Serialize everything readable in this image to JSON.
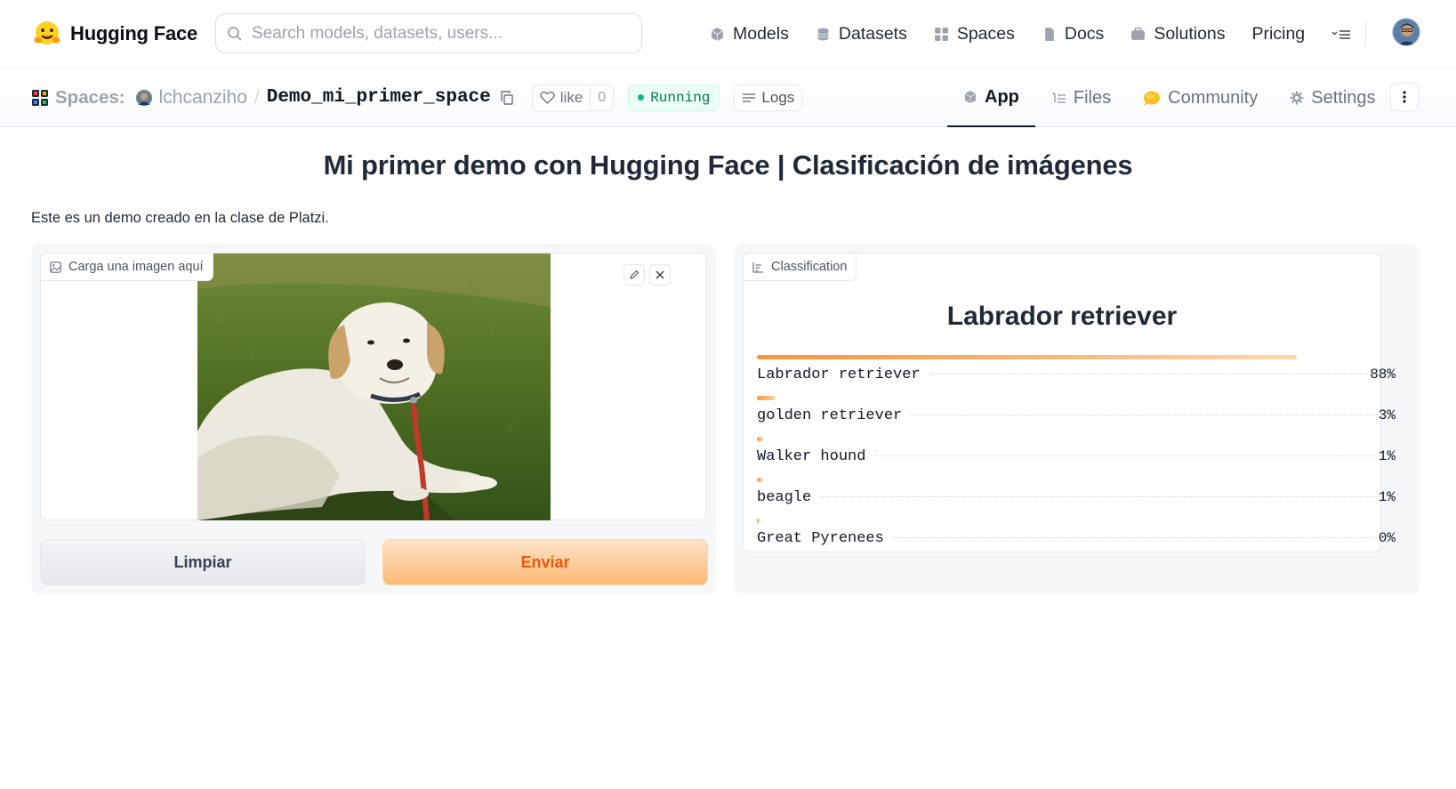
{
  "site": {
    "brand": "Hugging Face",
    "search_placeholder": "Search models, datasets, users..."
  },
  "nav": [
    {
      "label": "Models",
      "icon": "cube-icon"
    },
    {
      "label": "Datasets",
      "icon": "database-icon"
    },
    {
      "label": "Spaces",
      "icon": "grid-icon"
    },
    {
      "label": "Docs",
      "icon": "doc-icon"
    },
    {
      "label": "Solutions",
      "icon": "briefcase-icon"
    },
    {
      "label": "Pricing",
      "icon": ""
    }
  ],
  "space": {
    "spaces_label": "Spaces:",
    "owner": "lchcanziho",
    "name": "Demo_mi_primer_space",
    "like_label": "like",
    "like_count": "0",
    "status": "Running",
    "logs_label": "Logs"
  },
  "tabs": [
    {
      "label": "App",
      "active": true
    },
    {
      "label": "Files",
      "active": false
    },
    {
      "label": "Community",
      "active": false
    },
    {
      "label": "Settings",
      "active": false
    }
  ],
  "app": {
    "title": "Mi primer demo con Hugging Face | Clasificación de imágenes",
    "description": "Este es un demo creado en la clase de Platzi.",
    "input_label": "Carga una imagen aquí",
    "clear_button": "Limpiar",
    "submit_button": "Enviar",
    "output_label": "Classification",
    "top_prediction": "Labrador retriever",
    "confidences": [
      {
        "label": "Labrador retriever",
        "pct": "88%",
        "value": 0.88
      },
      {
        "label": "golden retriever",
        "pct": "3%",
        "value": 0.03
      },
      {
        "label": "Walker hound",
        "pct": "1%",
        "value": 0.01
      },
      {
        "label": "beagle",
        "pct": "1%",
        "value": 0.01
      },
      {
        "label": "Great Pyrenees",
        "pct": "0%",
        "value": 0.004
      }
    ]
  },
  "colors": {
    "accent": "#fb923c",
    "status_green": "#10b981",
    "submit_text": "#ea580c"
  }
}
